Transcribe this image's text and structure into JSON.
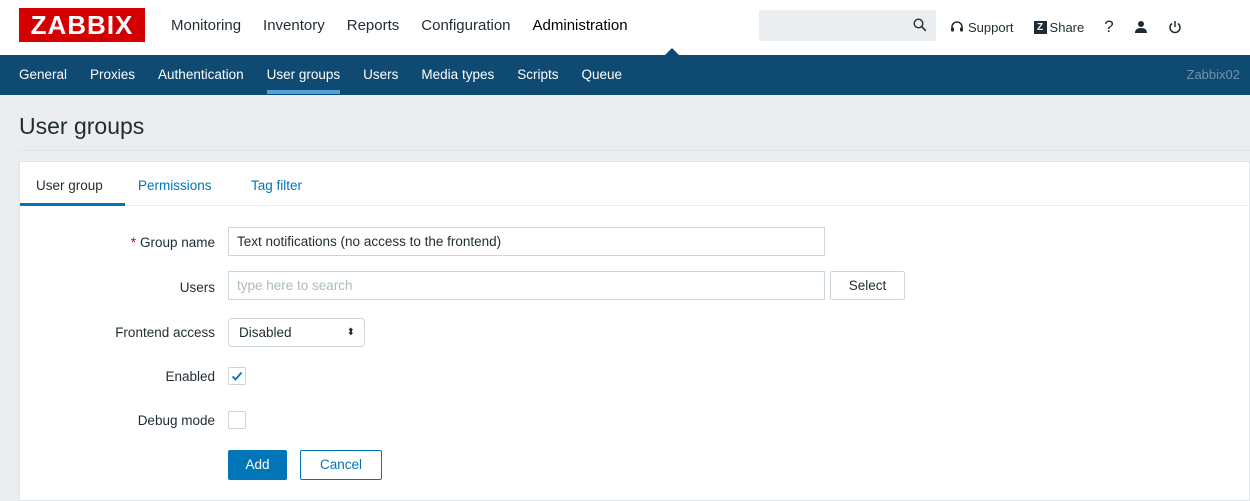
{
  "app": {
    "logo": "ZABBIX",
    "top_menu": [
      "Monitoring",
      "Inventory",
      "Reports",
      "Configuration",
      "Administration"
    ],
    "top_menu_active": "Administration",
    "search": {
      "value": "",
      "placeholder": ""
    },
    "support_label": "Support",
    "share_label": "Share",
    "share_box": "Z",
    "help_glyph": "?",
    "user_icon": "user-icon",
    "logout_icon": "power-icon"
  },
  "subnav": {
    "items": [
      "General",
      "Proxies",
      "Authentication",
      "User groups",
      "Users",
      "Media types",
      "Scripts",
      "Queue"
    ],
    "active": "User groups",
    "server_name": "Zabbix02"
  },
  "page": {
    "title": "User groups"
  },
  "tabs": [
    "User group",
    "Permissions",
    "Tag filter"
  ],
  "tabs_active": "User group",
  "form": {
    "group_name": {
      "required_mark": "*",
      "label": "Group name",
      "value": "Text notifications (no access to the frontend)"
    },
    "users": {
      "label": "Users",
      "placeholder": "type here to search",
      "select_label": "Select"
    },
    "frontend_access": {
      "label": "Frontend access",
      "value": "Disabled",
      "arrows": "⬍"
    },
    "enabled": {
      "label": "Enabled",
      "checked": true
    },
    "debug_mode": {
      "label": "Debug mode",
      "checked": false
    },
    "add_label": "Add",
    "cancel_label": "Cancel"
  },
  "colors": {
    "brand_red": "#d40000",
    "nav_blue": "#0e4a72",
    "accent_blue": "#0275b8",
    "active_underline": "#4fa2dc"
  }
}
